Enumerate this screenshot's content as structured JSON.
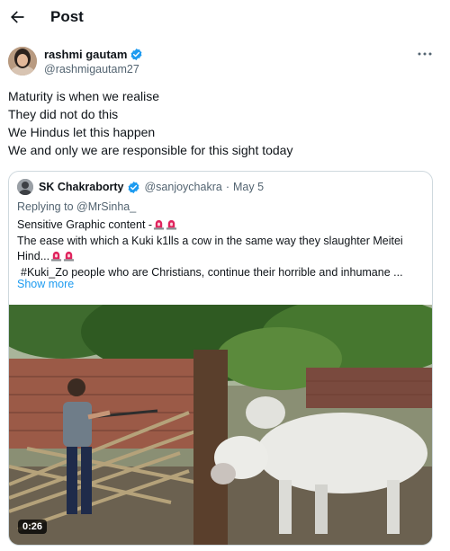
{
  "header": {
    "title": "Post",
    "back_icon": "arrow-left-icon"
  },
  "author": {
    "name": "rashmi gautam",
    "handle": "@rashmigautam27",
    "verified": true,
    "badge_color": "#1d9bf0"
  },
  "tweet": {
    "lines": [
      "Maturity is when we realise",
      "They did not do this",
      "We Hindus  let this happen",
      "We and only we are responsible for  this sight today"
    ]
  },
  "quoted": {
    "name": "SK Chakraborty",
    "handle": "@sanjoychakra",
    "separator": "·",
    "date": "May 5",
    "reply_to": "Replying to @MrSinha_",
    "line1": "Sensitive Graphic content -",
    "line2": "The ease with which a Kuki k1lls a cow in the same way they slaughter Meitei",
    "line3": "Hind...",
    "line4": "#Kuki_Zo people who are Christians, continue their horrible and inhumane ...",
    "show_more": "Show more",
    "siren_icon": "police-siren-icon"
  },
  "media": {
    "duration": "0:26"
  },
  "colors": {
    "link": "#1d9bf0",
    "muted": "#536471",
    "border": "#cfd9de"
  }
}
